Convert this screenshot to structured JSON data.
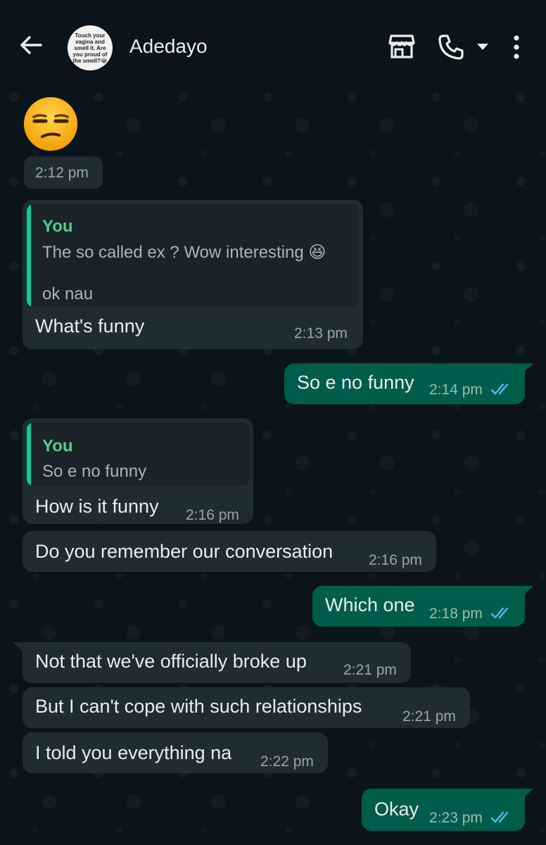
{
  "header": {
    "contact_name": "Adedayo",
    "avatar_text": "Touch your vagina and smell it. Are you proud of the smell?😂"
  },
  "messages": {
    "m0": {
      "emoji": "😒",
      "time": "2:12 pm"
    },
    "m1": {
      "quote_author": "You",
      "quote_line1": "The so called ex ? Wow interesting 😆",
      "quote_line2": "ok nau",
      "text": "What's funny",
      "time": "2:13 pm"
    },
    "m2": {
      "text": "So e no funny",
      "time": "2:14 pm"
    },
    "m3": {
      "quote_author": "You",
      "quote_line1": "So e no funny",
      "text": "How is it funny",
      "time": "2:16 pm"
    },
    "m4": {
      "text": "Do you remember our conversation",
      "time": "2:16 pm"
    },
    "m5": {
      "text": "Which one",
      "time": "2:18 pm"
    },
    "m6": {
      "text": "Not that we've officially broke up",
      "time": "2:21 pm"
    },
    "m7": {
      "text": "But I can't cope with such relationships",
      "time": "2:21 pm"
    },
    "m8": {
      "text": "I told you everything na",
      "time": "2:22 pm"
    },
    "m9": {
      "text": "Okay",
      "time": "2:23 pm"
    }
  },
  "colors": {
    "background": "#0b141a",
    "incoming_bubble": "#202c33",
    "outgoing_bubble": "#005c4b",
    "read_ticks": "#53bdeb",
    "quote_author": "#4fd08d"
  },
  "icons": [
    "back-arrow-icon",
    "store-icon",
    "phone-icon",
    "caret-down-icon",
    "more-vertical-icon",
    "double-check-icon"
  ]
}
